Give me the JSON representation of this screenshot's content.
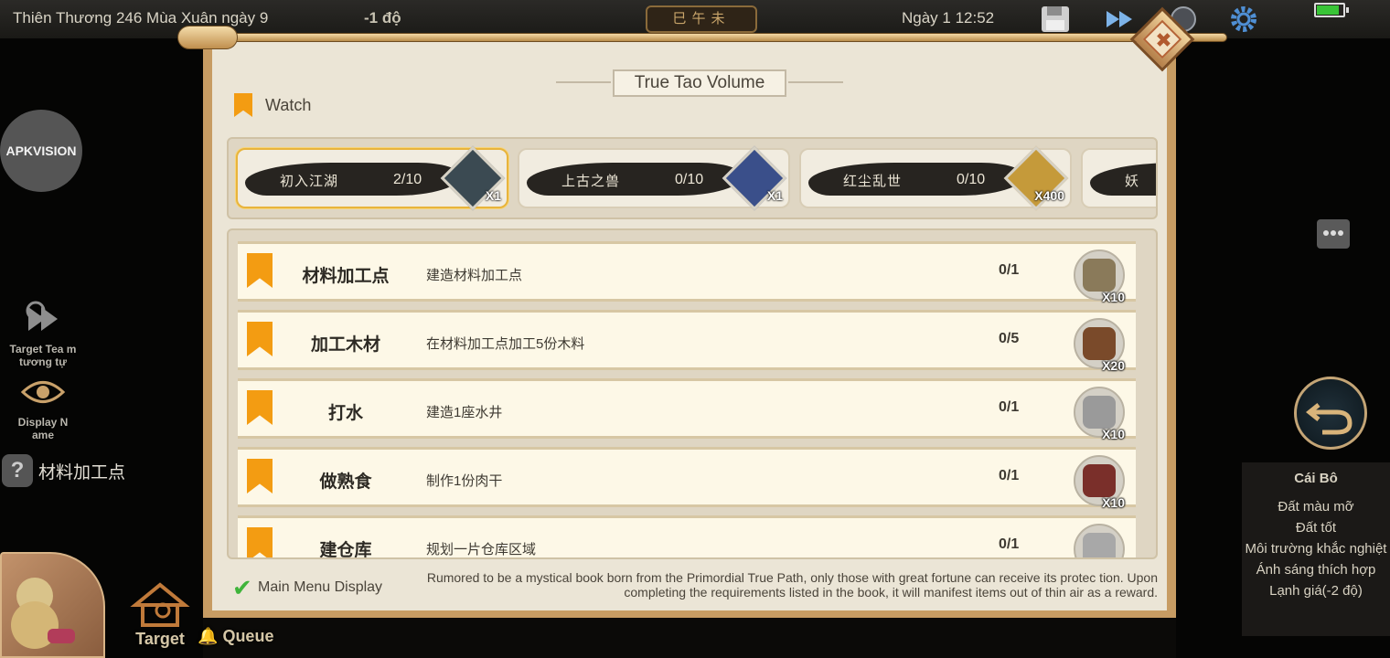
{
  "hud": {
    "season": "Thiên Thương 246 Mùa Xuân ngày 9",
    "temperature": "-1 độ",
    "era": "巳午未",
    "day_time": "Ngày 1 12:52",
    "battery_level": 0.85
  },
  "left": {
    "watermark": "APKVISION",
    "target_team_label": "Target Tea m tương tự",
    "display_name_label": "Display N ame",
    "current_quest": "材料加工点",
    "target_label": "Target",
    "queue_label": "Queue"
  },
  "right": {
    "soil": {
      "title": "Cái Bô",
      "lines": [
        "Đất màu mỡ",
        "Đất tốt",
        "Môi trường khắc nghiệt",
        "Ánh sáng thích hợp",
        "Lạnh giá(-2 độ)"
      ]
    }
  },
  "panel": {
    "title": "True Tao Volume",
    "watch_label": "Watch",
    "chapters": [
      {
        "name": "初入江湖",
        "progress": "2/10",
        "reward_count": "X1",
        "reward_icon": "vase-icon",
        "active": true
      },
      {
        "name": "上古之兽",
        "progress": "0/10",
        "reward_count": "X1",
        "reward_icon": "crystal-flower-icon",
        "active": false
      },
      {
        "name": "红尘乱世",
        "progress": "0/10",
        "reward_count": "X400",
        "reward_icon": "talisman-icon",
        "active": false
      },
      {
        "name": "妖",
        "progress": "",
        "reward_count": "",
        "reward_icon": "",
        "active": false
      }
    ],
    "tasks": [
      {
        "name": "材料加工点",
        "desc": "建造材料加工点",
        "progress": "0/1",
        "reward_count": "X10",
        "reward_icon": "ore-icon",
        "color": "#8a7a5a"
      },
      {
        "name": "加工木材",
        "desc": "在材料加工点加工5份木料",
        "progress": "0/5",
        "reward_count": "X20",
        "reward_icon": "wood-log-icon",
        "color": "#7a4a2a"
      },
      {
        "name": "打水",
        "desc": "建造1座水井",
        "progress": "0/1",
        "reward_count": "X10",
        "reward_icon": "stone-block-icon",
        "color": "#9a9a9a"
      },
      {
        "name": "做熟食",
        "desc": "制作1份肉干",
        "progress": "0/1",
        "reward_count": "X10",
        "reward_icon": "jerky-icon",
        "color": "#7a2f2a"
      },
      {
        "name": "建仓库",
        "desc": "规划一片仓库区域",
        "progress": "0/1",
        "reward_count": "",
        "reward_icon": "stone-slab-icon",
        "color": "#a8a8a8"
      }
    ],
    "menu_display_label": "Main Menu Display",
    "menu_display_checked": true,
    "footer_desc": "Rumored to be a mystical book born from the Primordial True Path, only those with great fortune can receive its protec tion. Upon completing the requirements listed in the book, it will manifest items out of thin air as a reward."
  }
}
